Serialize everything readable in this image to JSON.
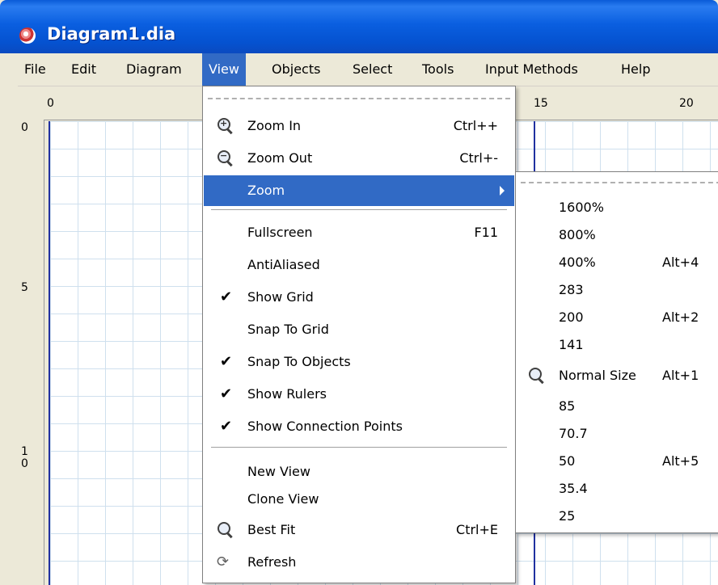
{
  "window": {
    "title": "Diagram1.dia"
  },
  "menubar": [
    {
      "label": "File"
    },
    {
      "label": "Edit"
    },
    {
      "label": "Diagram"
    },
    {
      "label": "View"
    },
    {
      "label": "Objects"
    },
    {
      "label": "Select"
    },
    {
      "label": "Tools"
    },
    {
      "label": "Input Methods"
    },
    {
      "label": "Help"
    }
  ],
  "rulers": {
    "top": [
      "0",
      "15",
      "20"
    ],
    "left": [
      "0",
      "5",
      "10"
    ]
  },
  "view_menu": {
    "zoom_in": {
      "label": "Zoom In",
      "shortcut": "Ctrl++",
      "icon": "zoom-in-icon"
    },
    "zoom_out": {
      "label": "Zoom Out",
      "shortcut": "Ctrl+-",
      "icon": "zoom-out-icon"
    },
    "zoom": {
      "label": "Zoom"
    },
    "fullscreen": {
      "label": "Fullscreen",
      "shortcut": "F11"
    },
    "antialiased": {
      "label": "AntiAliased"
    },
    "show_grid": {
      "label": "Show Grid",
      "checked": true
    },
    "snap_to_grid": {
      "label": "Snap To Grid",
      "checked": false
    },
    "snap_to_objects": {
      "label": "Snap To Objects",
      "checked": true
    },
    "show_rulers": {
      "label": "Show Rulers",
      "checked": true
    },
    "show_connection_points": {
      "label": "Show Connection Points",
      "checked": true
    },
    "new_view": {
      "label": "New View"
    },
    "clone_view": {
      "label": "Clone View"
    },
    "best_fit": {
      "label": "Best Fit",
      "shortcut": "Ctrl+E",
      "icon": "best-fit-icon"
    },
    "refresh": {
      "label": "Refresh",
      "icon": "refresh-icon"
    },
    "check_glyph": "✔"
  },
  "zoom_submenu": [
    {
      "label": "1600%",
      "shortcut": ""
    },
    {
      "label": "800%",
      "shortcut": ""
    },
    {
      "label": "400%",
      "shortcut": "Alt+4"
    },
    {
      "label": "283",
      "shortcut": ""
    },
    {
      "label": "200",
      "shortcut": "Alt+2"
    },
    {
      "label": "141",
      "shortcut": ""
    },
    {
      "label": "Normal Size",
      "shortcut": "Alt+1"
    },
    {
      "label": "85",
      "shortcut": ""
    },
    {
      "label": "70.7",
      "shortcut": ""
    },
    {
      "label": "50",
      "shortcut": "Alt+5"
    },
    {
      "label": "35.4",
      "shortcut": ""
    },
    {
      "label": "25",
      "shortcut": ""
    }
  ],
  "colors": {
    "highlight": "#316ac5",
    "grid": "#cfe0ee",
    "page_border": "#2030a0"
  }
}
